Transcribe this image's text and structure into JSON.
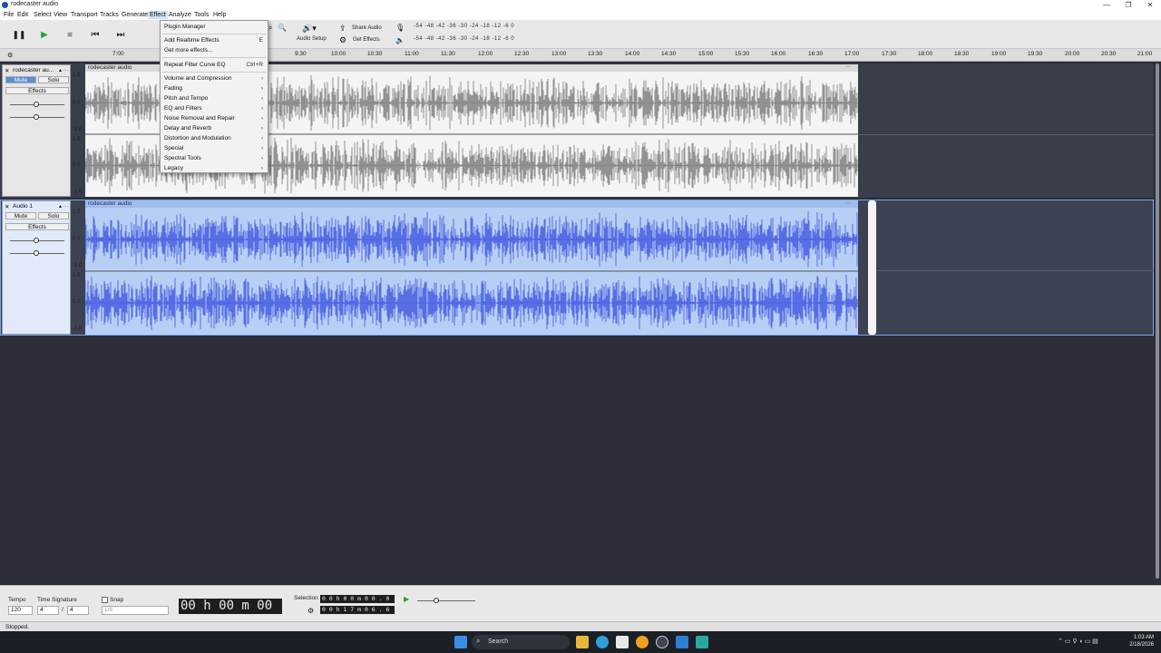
{
  "window": {
    "title": "rodecaster audio",
    "controls": [
      "—",
      "❐",
      "✕"
    ]
  },
  "menubar": [
    "File",
    "Edit",
    "Select",
    "View",
    "Transport",
    "Tracks",
    "Generate",
    "Effect",
    "Analyze",
    "Tools",
    "Help"
  ],
  "toolbar": {
    "audio_setup": "Audio Setup",
    "share_audio": "Share Audio",
    "get_effects": "Get Effects",
    "meter_scale": "-54 -48 -42 -36 -30 -24 -18 -12 -6 0",
    "meter_scale_play": "-54 -48 -42 -36 -30 -24 -18 -12 -6 0"
  },
  "ruler": {
    "ticks": [
      "7:00",
      "9:30",
      "10:00",
      "10:30",
      "11:00",
      "11:30",
      "12:00",
      "12:30",
      "13:00",
      "13:30",
      "14:00",
      "14:30",
      "15:00",
      "15:30",
      "16:00",
      "16:30",
      "17:00",
      "17:30",
      "18:00",
      "18:30",
      "19:00",
      "19:30",
      "20:00",
      "20:30",
      "21:00"
    ]
  },
  "tracks": [
    {
      "name": "rodecaster au...",
      "clip": "rodecaster audio",
      "mute": "Mute",
      "solo": "Solo",
      "effects": "Effects",
      "selected": false,
      "mute_on": true
    },
    {
      "name": "Audio 1",
      "clip": "rodecaster audio",
      "mute": "Mute",
      "solo": "Solo",
      "effects": "Effects",
      "selected": true,
      "mute_on": false
    }
  ],
  "scale_labels": [
    "1.0",
    "0.0",
    "-1.0",
    "1.0",
    "0.0",
    "-1.0"
  ],
  "effect_menu": {
    "items": [
      {
        "label": "Plugin Manager",
        "shortcut": "",
        "submenu": false
      },
      {
        "label": "Add Realtime Effects",
        "shortcut": "E",
        "submenu": false
      },
      {
        "label": "Get more effects...",
        "shortcut": "",
        "submenu": false
      },
      {
        "label": "Repeat Filter Curve EQ",
        "shortcut": "Ctrl+R",
        "submenu": false
      },
      {
        "label": "Volume and Compression",
        "shortcut": "",
        "submenu": true
      },
      {
        "label": "Fading",
        "shortcut": "",
        "submenu": true
      },
      {
        "label": "Pitch and Tempo",
        "shortcut": "",
        "submenu": true
      },
      {
        "label": "EQ and Filters",
        "shortcut": "",
        "submenu": true
      },
      {
        "label": "Noise Removal and Repair",
        "shortcut": "",
        "submenu": true
      },
      {
        "label": "Delay and Reverb",
        "shortcut": "",
        "submenu": true
      },
      {
        "label": "Distortion and Modulation",
        "shortcut": "",
        "submenu": true
      },
      {
        "label": "Special",
        "shortcut": "",
        "submenu": true
      },
      {
        "label": "Spectral Tools",
        "shortcut": "",
        "submenu": true
      },
      {
        "label": "Legacy",
        "shortcut": "",
        "submenu": true
      }
    ]
  },
  "bottombar": {
    "tempo_label": "Tempo",
    "tempo_value": "120",
    "timesig_label": "Time Signature",
    "timesig_num": "4",
    "timesig_sep": "/",
    "timesig_den": "4",
    "snap_label": "Snap",
    "snap_value": "1/8",
    "time_display": "00 h 00 m 00 s",
    "selection_label": "Selection",
    "sel_start": "0 0 h 0 0 m 0 0 . 0 0 0 s",
    "sel_end": "0 0 h 1 7 m 0 6 . 6 4 8 s"
  },
  "status": "Stopped.",
  "taskbar": {
    "search": "Search",
    "time": "1:03 AM",
    "date": "2/18/2026"
  },
  "colors": {
    "accent": "#5b8fd6",
    "selected_wave": "#3f56e0",
    "unselected_wave": "#7a7a7a",
    "selection_bg": "#b8cff5"
  }
}
